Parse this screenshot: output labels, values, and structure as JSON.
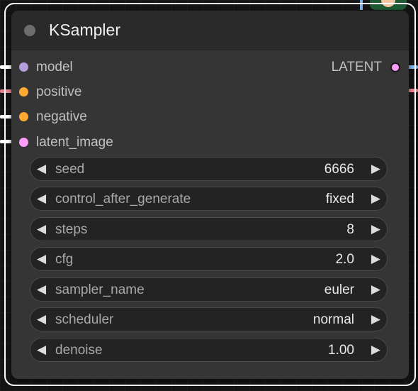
{
  "node": {
    "title": "KSampler",
    "inputs": [
      {
        "label": "model",
        "color": "#b39ddb"
      },
      {
        "label": "positive",
        "color": "#ffa931"
      },
      {
        "label": "negative",
        "color": "#ffa931"
      },
      {
        "label": "latent_image",
        "color": "#ff9cf9"
      }
    ],
    "output": {
      "label": "LATENT",
      "color": "#ff9cf9"
    },
    "widgets": [
      {
        "label": "seed",
        "value": "6666"
      },
      {
        "label": "control_after_generate",
        "value": "fixed"
      },
      {
        "label": "steps",
        "value": "8"
      },
      {
        "label": "cfg",
        "value": "2.0"
      },
      {
        "label": "sampler_name",
        "value": "euler"
      },
      {
        "label": "scheduler",
        "value": "normal"
      },
      {
        "label": "denoise",
        "value": "1.00"
      }
    ],
    "arrow_left": "◀",
    "arrow_right": "▶"
  },
  "wires": {
    "model_color": "#ffffff",
    "positive_color": "#e8838e",
    "negative_color": "#ffffff",
    "latent_color": "#ffffff",
    "output_color": "#7fb0e6",
    "output2_color": "#e8838e"
  }
}
